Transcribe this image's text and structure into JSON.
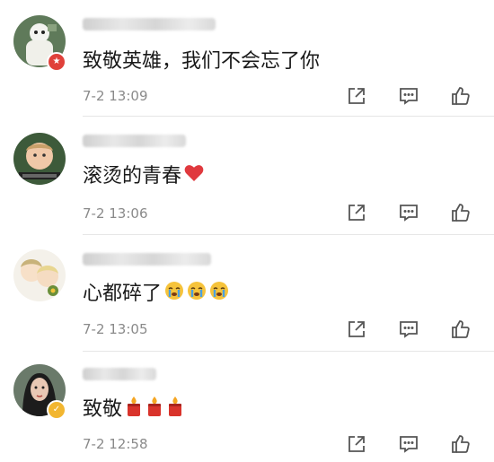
{
  "comments": [
    {
      "text": "致敬英雄，我们不会忘了你",
      "time": "7-2 13:09",
      "emojis": []
    },
    {
      "text": "滚烫的青春",
      "time": "7-2 13:06",
      "emojis": [
        "heart-emoji"
      ]
    },
    {
      "text": "心都碎了",
      "time": "7-2 13:05",
      "emojis": [
        "crying-emoji",
        "crying-emoji",
        "crying-emoji"
      ]
    },
    {
      "text": "致敬",
      "time": "7-2 12:58",
      "emojis": [
        "candle-emoji",
        "candle-emoji",
        "candle-emoji"
      ]
    }
  ],
  "actions": [
    "share-icon",
    "reply-icon",
    "like-icon"
  ],
  "colors": {
    "badge_red": "#e0413a",
    "badge_gold": "#f2b630",
    "heart": "#e0393e",
    "candle": "#d9332b",
    "flame": "#f5a623",
    "icon": "#555555",
    "time": "#8a8a8a"
  }
}
